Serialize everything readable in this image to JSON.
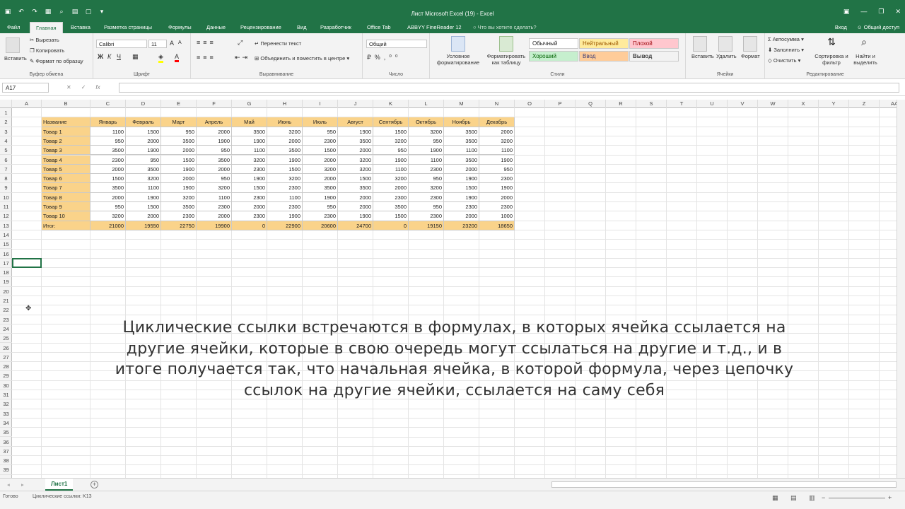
{
  "window": {
    "title": "Лист Microsoft Excel (19) - Excel"
  },
  "tabs": {
    "file": "Файл",
    "home": "Главная",
    "insert": "Вставка",
    "layout": "Разметка страницы",
    "formulas": "Формулы",
    "data": "Данные",
    "review": "Рецензирование",
    "view": "Вид",
    "developer": "Разработчик",
    "officetab": "Office Tab",
    "abbyy": "ABBYY FineReader 12",
    "tellme": "Что вы хотите сделать?",
    "signin": "Вход",
    "share": "Общий доступ"
  },
  "ribbon": {
    "clipboard": {
      "label": "Буфер обмена",
      "paste": "Вставить",
      "cut": "Вырезать",
      "copy": "Копировать",
      "format_painter": "Формат по образцу"
    },
    "font": {
      "label": "Шрифт",
      "name": "Calibri",
      "size": "11"
    },
    "alignment": {
      "label": "Выравнивание",
      "wrap": "Перенести текст",
      "merge": "Объединить и поместить в центре"
    },
    "number": {
      "label": "Число",
      "format": "Общий"
    },
    "styles": {
      "label": "Стили",
      "conditional": "Условное форматирование",
      "as_table": "Форматировать как таблицу",
      "normal": "Обычный",
      "neutral": "Нейтральный",
      "bad": "Плохой",
      "good": "Хороший",
      "input": "Ввод",
      "output": "Вывод"
    },
    "cells": {
      "label": "Ячейки",
      "insert": "Вставить",
      "delete": "Удалить",
      "format": "Формат"
    },
    "editing": {
      "label": "Редактирование",
      "autosum": "Автосумма",
      "fill": "Заполнить",
      "clear": "Очистить",
      "sort": "Сортировка и фильтр",
      "find": "Найти и выделить"
    }
  },
  "formula_bar": {
    "name_box": "A17",
    "fx": "fx",
    "formula": ""
  },
  "columns": [
    "A",
    "B",
    "C",
    "D",
    "E",
    "F",
    "G",
    "H",
    "I",
    "J",
    "K",
    "L",
    "M",
    "N",
    "O",
    "P",
    "Q",
    "R",
    "S",
    "T",
    "U",
    "V",
    "W",
    "X",
    "Y",
    "Z",
    "AA"
  ],
  "rows": [
    "1",
    "2",
    "3",
    "4",
    "5",
    "6",
    "7",
    "8",
    "9",
    "10",
    "11",
    "12",
    "13",
    "14",
    "15",
    "16",
    "17",
    "18",
    "19",
    "20",
    "21",
    "22",
    "23",
    "24",
    "25",
    "26",
    "27",
    "28",
    "29",
    "30",
    "31",
    "32",
    "33",
    "34",
    "35",
    "36",
    "37",
    "38",
    "39"
  ],
  "table": {
    "headers": [
      "Название",
      "Январь",
      "Февраль",
      "Март",
      "Апрель",
      "Май",
      "Июнь",
      "Июль",
      "Август",
      "Сентябрь",
      "Октябрь",
      "Ноябрь",
      "Декабрь"
    ],
    "rows": [
      [
        "Товар 1",
        "1100",
        "1500",
        "950",
        "2000",
        "3500",
        "3200",
        "950",
        "1900",
        "1500",
        "3200",
        "3500",
        "2000"
      ],
      [
        "Товар 2",
        "950",
        "2000",
        "3500",
        "1900",
        "1900",
        "2000",
        "2300",
        "3500",
        "3200",
        "950",
        "3500",
        "3200"
      ],
      [
        "Товар 3",
        "3500",
        "1900",
        "2000",
        "950",
        "1100",
        "3500",
        "1500",
        "2000",
        "950",
        "1900",
        "1100",
        "1100"
      ],
      [
        "Товар 4",
        "2300",
        "950",
        "1500",
        "3500",
        "3200",
        "1900",
        "2000",
        "3200",
        "1900",
        "1100",
        "3500",
        "1900"
      ],
      [
        "Товар 5",
        "2000",
        "3500",
        "1900",
        "2000",
        "2300",
        "1500",
        "3200",
        "3200",
        "1100",
        "2300",
        "2000",
        "950"
      ],
      [
        "Товар 6",
        "1500",
        "3200",
        "2000",
        "950",
        "1900",
        "3200",
        "2000",
        "1500",
        "3200",
        "950",
        "1900",
        "2300"
      ],
      [
        "Товар 7",
        "3500",
        "1100",
        "1900",
        "3200",
        "1500",
        "2300",
        "3500",
        "3500",
        "2000",
        "3200",
        "1500",
        "1900"
      ],
      [
        "Товар 8",
        "2000",
        "1900",
        "3200",
        "1100",
        "2300",
        "1100",
        "1900",
        "2000",
        "2300",
        "2300",
        "1900",
        "2000"
      ],
      [
        "Товар 9",
        "950",
        "1500",
        "3500",
        "2300",
        "2000",
        "2300",
        "950",
        "2000",
        "3500",
        "950",
        "2300",
        "2300"
      ],
      [
        "Товар 10",
        "3200",
        "2000",
        "2300",
        "2000",
        "2300",
        "1900",
        "2300",
        "1900",
        "1500",
        "2300",
        "2000",
        "1000"
      ]
    ],
    "total": [
      "Итог:",
      "21000",
      "19550",
      "22750",
      "19900",
      "0",
      "22900",
      "20600",
      "24700",
      "0",
      "19150",
      "23200",
      "18650"
    ]
  },
  "caption": "Циклические ссылки встречаются в формулах, в которых ячейка ссылается на другие ячейки, которые в свою очередь могут ссылаться на другие и т.д., и в итоге получается так, что начальная ячейка, в которой формула, через цепочку ссылок на другие ячейки, ссылается на саму себя",
  "sheet_tab": "Лист1",
  "status": {
    "ready": "Готово",
    "circular": "Циклические ссылки: K13"
  },
  "colors": {
    "excel_green": "#217346",
    "table_fill": "#fad38a"
  }
}
